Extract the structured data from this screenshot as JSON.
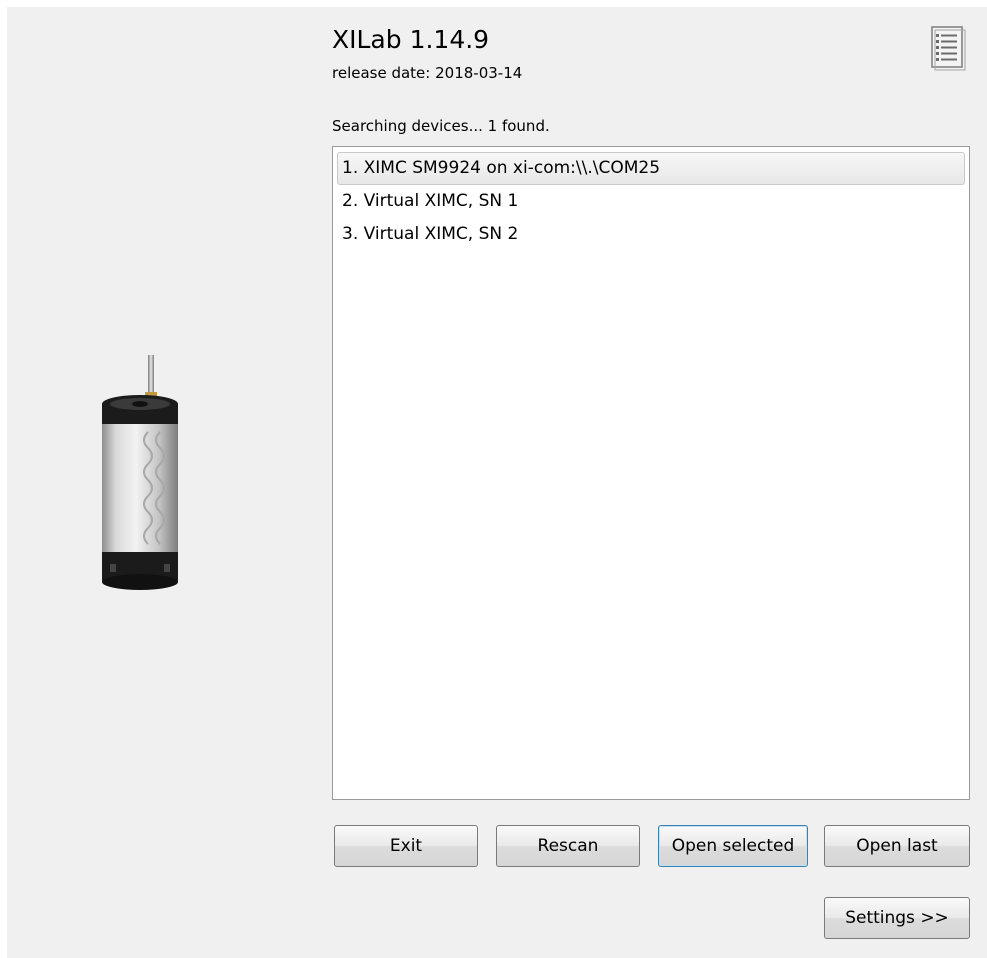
{
  "app": {
    "title": "XILab 1.14.9",
    "release_date": "release date: 2018-03-14"
  },
  "status_text": "Searching devices... 1 found.",
  "devices": [
    {
      "label": "1. XIMC SM9924 on xi-com:\\\\.\\COM25",
      "selected": true
    },
    {
      "label": "2. Virtual XIMC, SN 1",
      "selected": false
    },
    {
      "label": "3. Virtual XIMC, SN 2",
      "selected": false
    }
  ],
  "buttons": {
    "exit": "Exit",
    "rescan": "Rescan",
    "open_selected": "Open selected",
    "open_last": "Open last",
    "settings": "Settings >>"
  },
  "icons": {
    "log": "document-list-icon",
    "motor": "stepper-motor-image"
  },
  "colors": {
    "window_bg": "#f0f0f0",
    "list_bg": "#ffffff",
    "selection_bg": "#ececec"
  }
}
